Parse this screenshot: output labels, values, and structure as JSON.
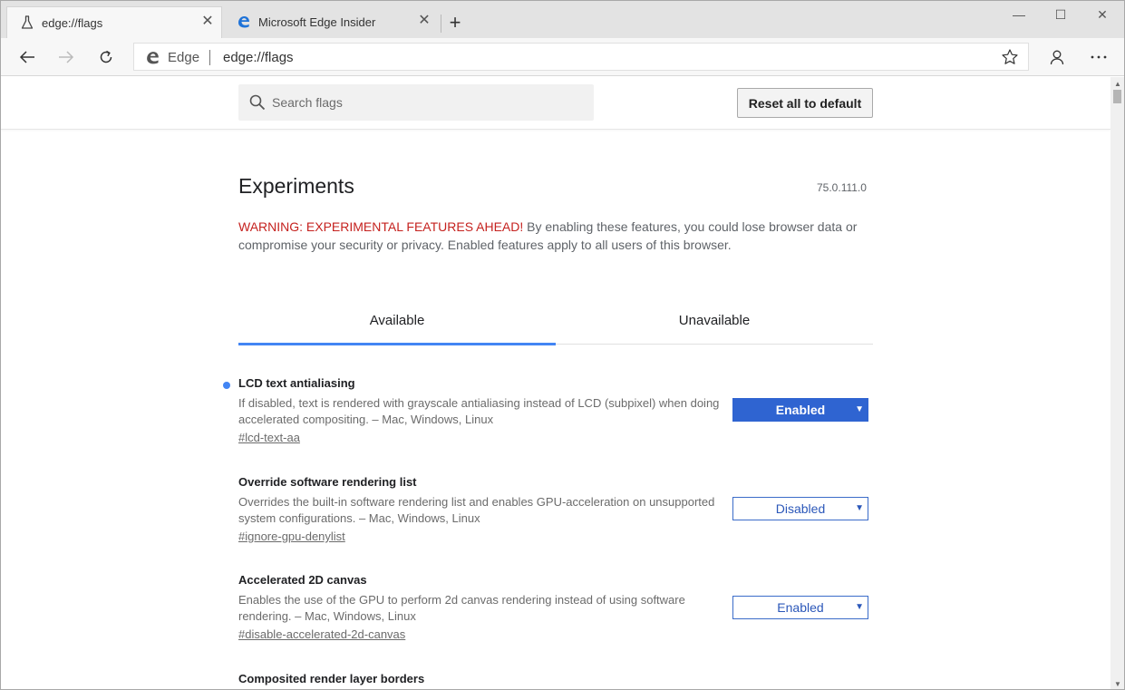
{
  "tabs": [
    {
      "title": "edge://flags",
      "icon": "flask-icon"
    },
    {
      "title": "Microsoft Edge Insider",
      "icon": "edge-logo-icon"
    }
  ],
  "window_controls": {
    "minimize": "—",
    "maximize": "☐",
    "close": "✕"
  },
  "toolbar": {
    "brand": "Edge",
    "url": "edge://flags"
  },
  "page": {
    "search_placeholder": "Search flags",
    "reset_label": "Reset all to default",
    "heading": "Experiments",
    "version": "75.0.111.0",
    "warning_prefix": "WARNING: EXPERIMENTAL FEATURES AHEAD!",
    "warning_text": "By enabling these features, you could lose browser data or compromise your security or privacy. Enabled features apply to all users of this browser.",
    "tab_available": "Available",
    "tab_unavailable": "Unavailable"
  },
  "flags": [
    {
      "name": "LCD text antialiasing",
      "description": "If disabled, text is rendered with grayscale antialiasing instead of LCD (subpixel) when doing accelerated compositing. – Mac, Windows, Linux",
      "tag": "#lcd-text-aa",
      "value": "Enabled",
      "modified": true
    },
    {
      "name": "Override software rendering list",
      "description": "Overrides the built-in software rendering list and enables GPU-acceleration on unsupported system configurations. – Mac, Windows, Linux",
      "tag": "#ignore-gpu-denylist",
      "value": "Disabled",
      "modified": false
    },
    {
      "name": "Accelerated 2D canvas",
      "description": "Enables the use of the GPU to perform 2d canvas rendering instead of using software rendering. – Mac, Windows, Linux",
      "tag": "#disable-accelerated-2d-canvas",
      "value": "Enabled",
      "modified": false
    },
    {
      "name": "Composited render layer borders"
    }
  ],
  "colors": {
    "accent": "#4285f4",
    "warning": "#c5221f",
    "select_blue": "#2f64d1"
  }
}
